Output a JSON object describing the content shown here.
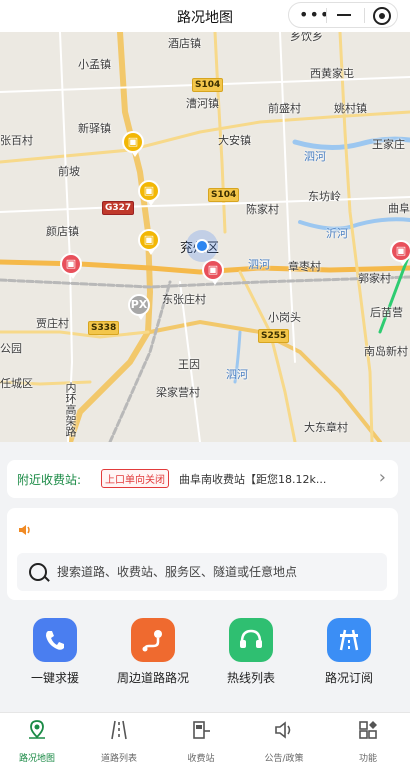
{
  "header": {
    "title": "路况地图"
  },
  "map": {
    "places": [
      {
        "name": "酒店镇",
        "k": "p1"
      },
      {
        "name": "乡饮乡",
        "k": "p2"
      },
      {
        "name": "小孟镇",
        "k": "p3"
      },
      {
        "name": "西黄家屯",
        "k": "p4"
      },
      {
        "name": "漕河镇",
        "k": "p5"
      },
      {
        "name": "前盛村",
        "k": "p6"
      },
      {
        "name": "姚村镇",
        "k": "p7"
      },
      {
        "name": "新驿镇",
        "k": "p8"
      },
      {
        "name": "大安镇",
        "k": "p9"
      },
      {
        "name": "张百村",
        "k": "p10"
      },
      {
        "name": "王家庄",
        "k": "p11"
      },
      {
        "name": "前坡",
        "k": "p12"
      },
      {
        "name": "东坊岭",
        "k": "p13"
      },
      {
        "name": "陈家村",
        "k": "p14"
      },
      {
        "name": "颜店镇",
        "k": "p15"
      },
      {
        "name": "兖州区",
        "k": "p16"
      },
      {
        "name": "章枣村",
        "k": "p17"
      },
      {
        "name": "郭家村",
        "k": "p18"
      },
      {
        "name": "东张庄村",
        "k": "p19"
      },
      {
        "name": "贾庄村",
        "k": "p20"
      },
      {
        "name": "后苗营",
        "k": "p21"
      },
      {
        "name": "小岗头",
        "k": "p22"
      },
      {
        "name": "公园",
        "k": "p23"
      },
      {
        "name": "南岛新村",
        "k": "p24"
      },
      {
        "name": "任城区",
        "k": "p25"
      },
      {
        "name": "王因",
        "k": "p26"
      },
      {
        "name": "梁家营村",
        "k": "p27"
      },
      {
        "name": "内环高架路",
        "k": "p28"
      },
      {
        "name": "大东章村",
        "k": "p29"
      },
      {
        "name": "曲阜",
        "k": "p30"
      }
    ],
    "rivers": [
      {
        "name": "泗河",
        "k": "r1"
      },
      {
        "name": "沂河",
        "k": "r2"
      },
      {
        "name": "泗河",
        "k": "r3"
      },
      {
        "name": "泗河",
        "k": "r4"
      }
    ],
    "shields": [
      {
        "code": "S104",
        "k": "s1"
      },
      {
        "code": "S104",
        "k": "s2"
      },
      {
        "code": "G327",
        "k": "s3"
      },
      {
        "code": "S338",
        "k": "s4"
      },
      {
        "code": "S255",
        "k": "s5"
      }
    ],
    "px_label": "PX"
  },
  "toll": {
    "label": "附近收费站:",
    "status_badge": "上口单向关闭",
    "station": "曲阜南收费站【距您18.12k..."
  },
  "search": {
    "placeholder": "搜索道路、收费站、服务区、隧道或任意地点",
    "value": ""
  },
  "quick_actions": [
    {
      "label": "一键求援",
      "icon": "phone-icon",
      "color": "#4a7ef0"
    },
    {
      "label": "周边道路路况",
      "icon": "route-icon",
      "color": "#ef6a2f"
    },
    {
      "label": "热线列表",
      "icon": "headset-icon",
      "color": "#2fbf71"
    },
    {
      "label": "路况订阅",
      "icon": "road-icon",
      "color": "#3b8ef5"
    }
  ],
  "tabs": [
    {
      "label": "路况地图",
      "active": true
    },
    {
      "label": "道路列表",
      "active": false
    },
    {
      "label": "收费站",
      "active": false
    },
    {
      "label": "公告/政策",
      "active": false
    },
    {
      "label": "功能",
      "active": false
    }
  ],
  "colors": {
    "accent": "#1a8a45",
    "badge": "#e23b3b"
  }
}
